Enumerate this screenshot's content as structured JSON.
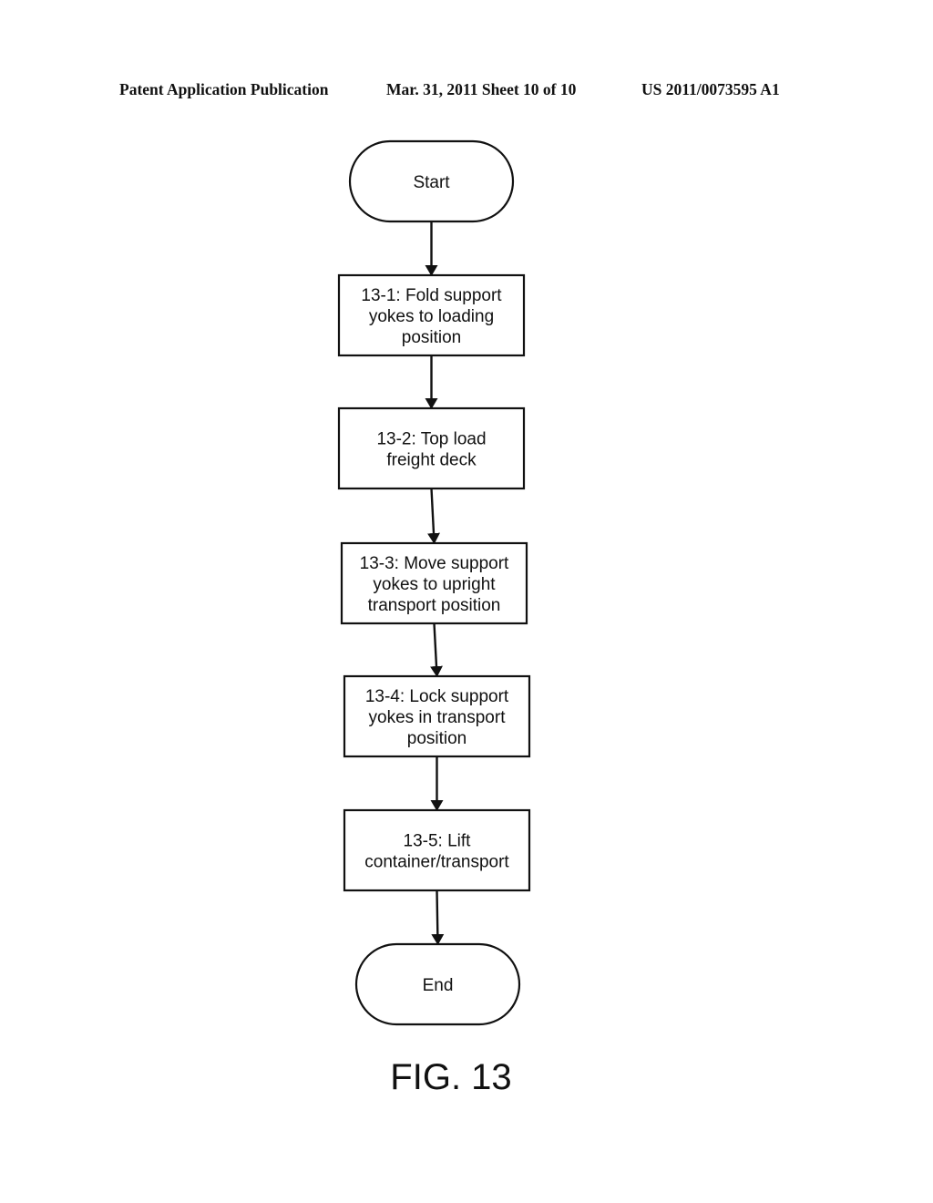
{
  "header": {
    "left": "Patent Application Publication",
    "center": "Mar. 31, 2011  Sheet 10 of 10",
    "right": "US 2011/0073595 A1"
  },
  "flowchart": {
    "nodes": [
      {
        "id": "start",
        "type": "terminal",
        "lines": [
          "Start"
        ]
      },
      {
        "id": "13-1",
        "type": "process",
        "lines": [
          "13-1:  Fold support",
          "yokes to loading",
          "position"
        ]
      },
      {
        "id": "13-2",
        "type": "process",
        "lines": [
          "13-2:  Top load",
          "freight deck"
        ]
      },
      {
        "id": "13-3",
        "type": "process",
        "lines": [
          "13-3:  Move support",
          "yokes to upright",
          "transport position"
        ]
      },
      {
        "id": "13-4",
        "type": "process",
        "lines": [
          "13-4:  Lock support",
          "yokes in transport",
          "position"
        ]
      },
      {
        "id": "13-5",
        "type": "process",
        "lines": [
          "13-5:  Lift",
          "container/transport"
        ]
      },
      {
        "id": "end",
        "type": "terminal",
        "lines": [
          "End"
        ]
      }
    ],
    "edges": [
      [
        "start",
        "13-1"
      ],
      [
        "13-1",
        "13-2"
      ],
      [
        "13-2",
        "13-3"
      ],
      [
        "13-3",
        "13-4"
      ],
      [
        "13-4",
        "13-5"
      ],
      [
        "13-5",
        "end"
      ]
    ]
  },
  "figure_label": "FIG. 13"
}
